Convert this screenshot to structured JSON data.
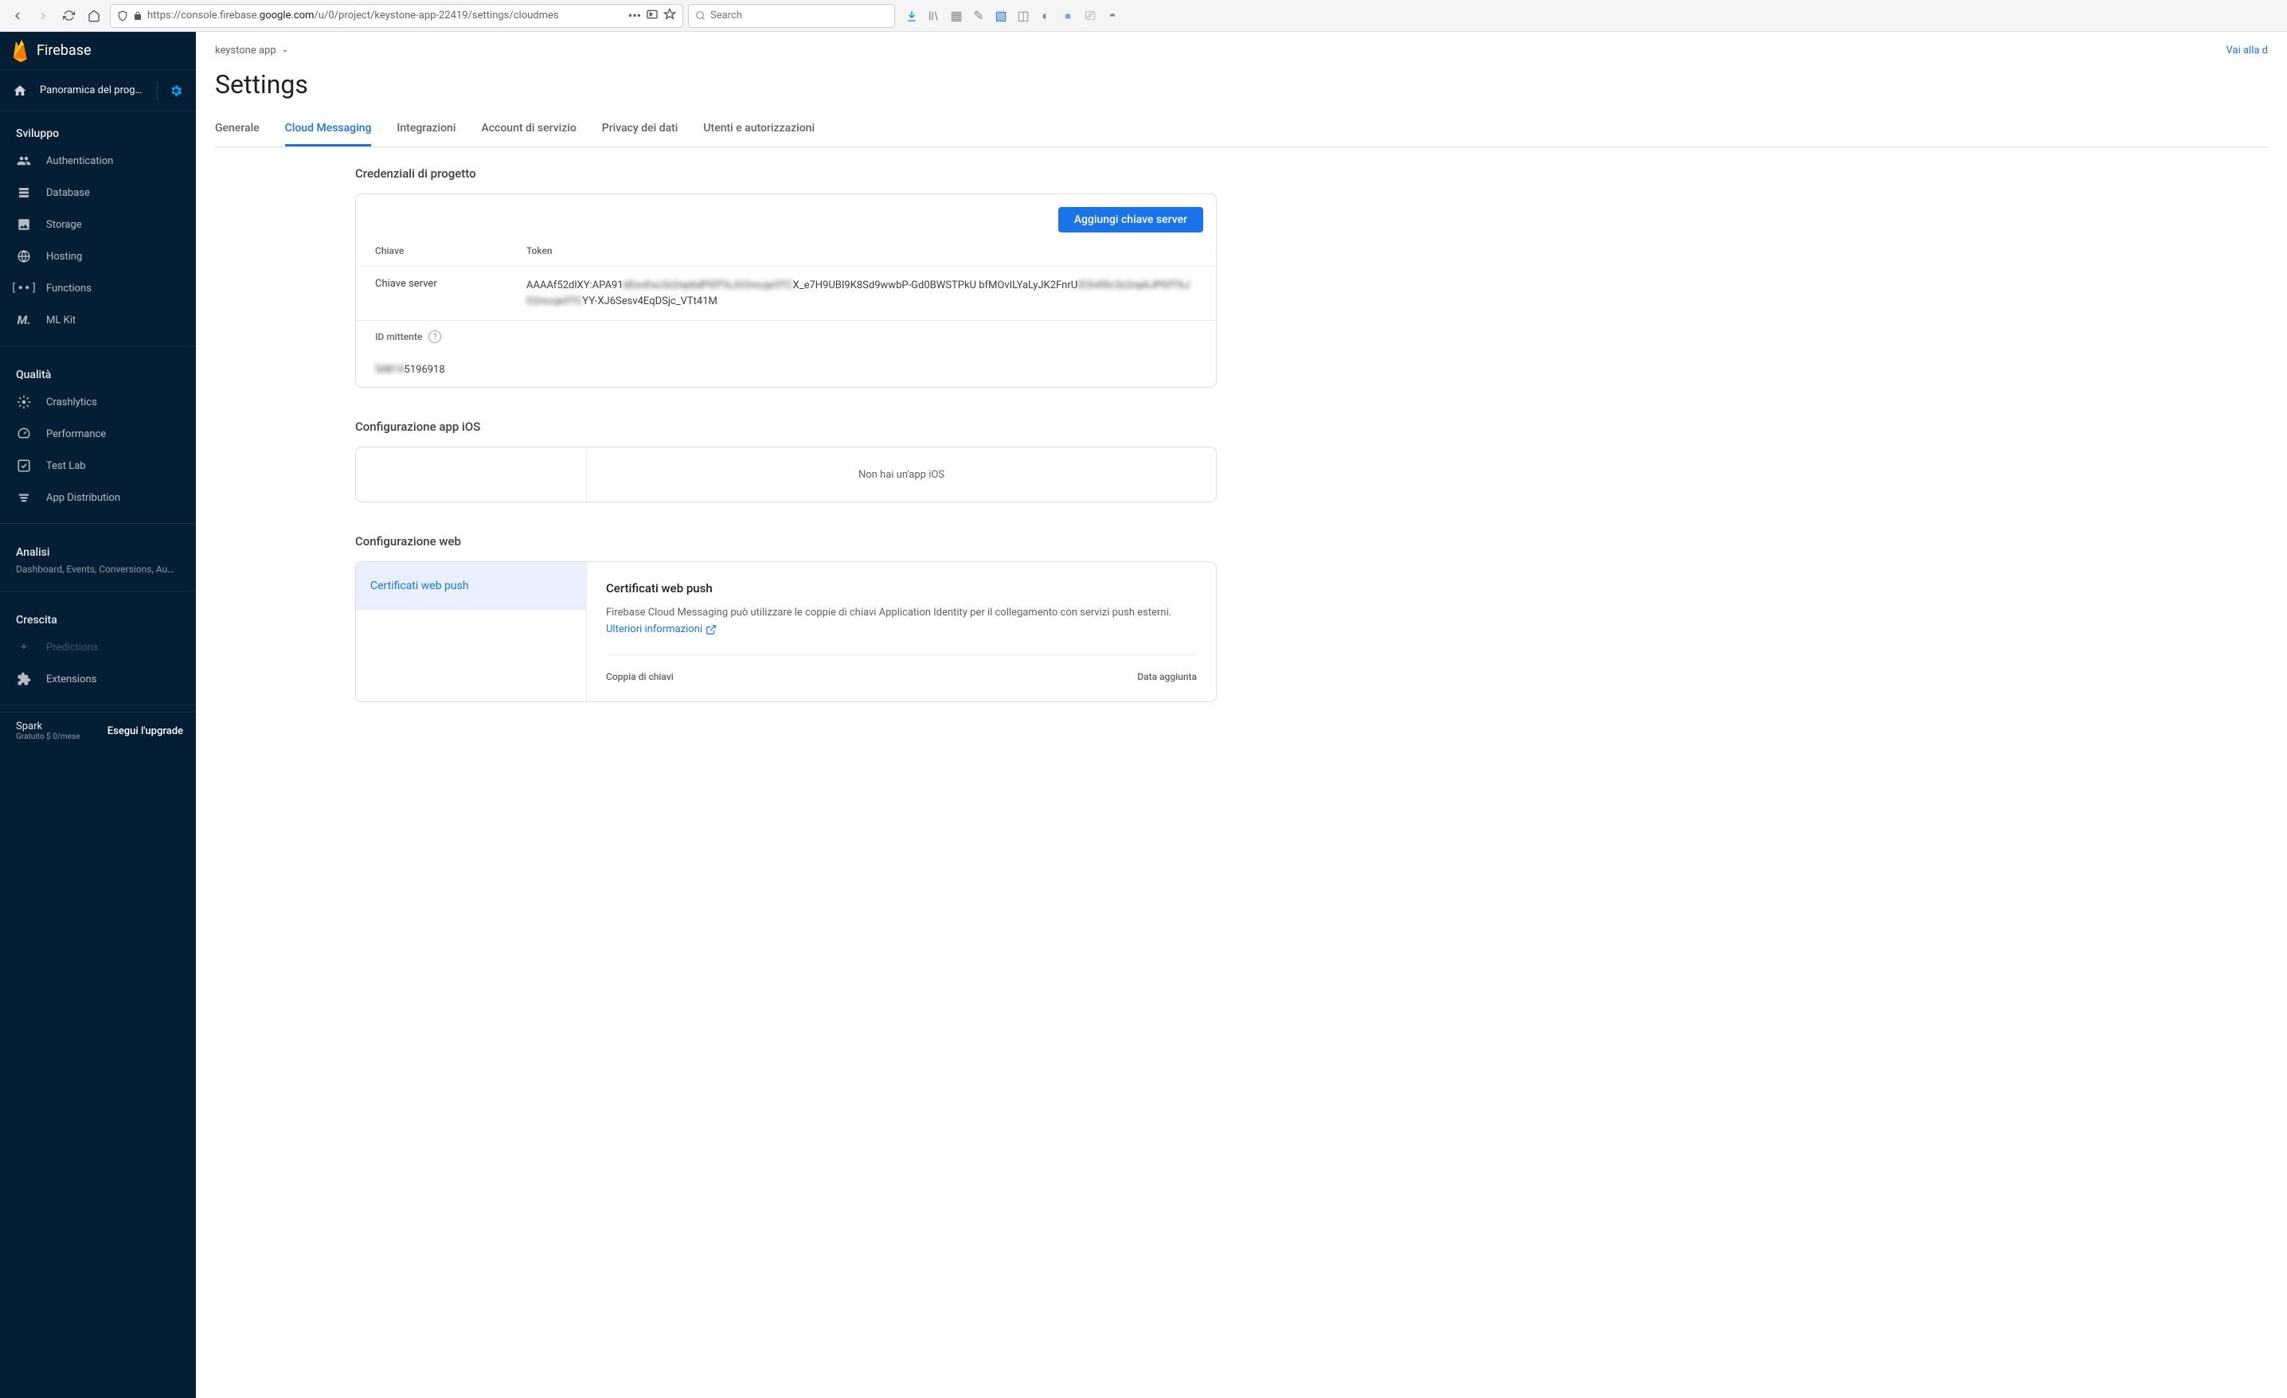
{
  "browser": {
    "url_prefix": "https://console.firebase.",
    "url_domain": "google.com",
    "url_suffix": "/u/0/project/keystone-app-22419/settings/cloudmes",
    "search_placeholder": "Search"
  },
  "sidebar": {
    "brand": "Firebase",
    "overview": "Panoramica del progetto",
    "sections": {
      "develop": {
        "title": "Sviluppo",
        "items": [
          "Authentication",
          "Database",
          "Storage",
          "Hosting",
          "Functions",
          "ML Kit"
        ]
      },
      "quality": {
        "title": "Qualità",
        "items": [
          "Crashlytics",
          "Performance",
          "Test Lab",
          "App Distribution"
        ]
      },
      "analytics": {
        "title": "Analisi",
        "subtitle": "Dashboard, Events, Conversions, Au…"
      },
      "grow": {
        "title": "Crescita",
        "items": [
          "Predictions",
          "Extensions"
        ]
      }
    },
    "footer": {
      "plan": "Spark",
      "plan_sub": "Gratuito $ 0/mese",
      "upgrade": "Esegui l'upgrade"
    }
  },
  "breadcrumb": {
    "app_name": "keystone app",
    "docs_link": "Vai alla d"
  },
  "page_title": "Settings",
  "tabs": [
    "Generale",
    "Cloud Messaging",
    "Integrazioni",
    "Account di servizio",
    "Privacy dei dati",
    "Utenti e autorizzazioni"
  ],
  "credentials": {
    "title": "Credenziali di progetto",
    "add_server_key": "Aggiungi chiave server",
    "th_key": "Chiave",
    "th_token": "Token",
    "server_key_label": "Chiave server",
    "server_key_token": "AAAAf52dlXY:APA91bEsvEsc3z2np6dPGfT6JO2nccje3TCX_e7H9UBI9K8Sd9wwbP-Gd0BWSTPkU bfMOvILYaLyJK2FnrUiD3v0Sc3z2np6JPGfT6JO2nccje3TCYY-XJ6Sesv4EqDSjc_VTt41M",
    "sender_id_label": "ID mittente",
    "sender_id_value": "548145196918"
  },
  "ios": {
    "title": "Configurazione app iOS",
    "empty": "Non hai un'app iOS"
  },
  "web": {
    "title": "Configurazione web",
    "left_item": "Certificati web push",
    "right_title": "Certificati web push",
    "right_desc": "Firebase Cloud Messaging può utilizzare le coppie di chiavi Application Identity per il collegamento con servizi push esterni. ",
    "more_info": "Ulteriori informazioni",
    "th_pair": "Coppia di chiavi",
    "th_date": "Data aggiunta"
  }
}
